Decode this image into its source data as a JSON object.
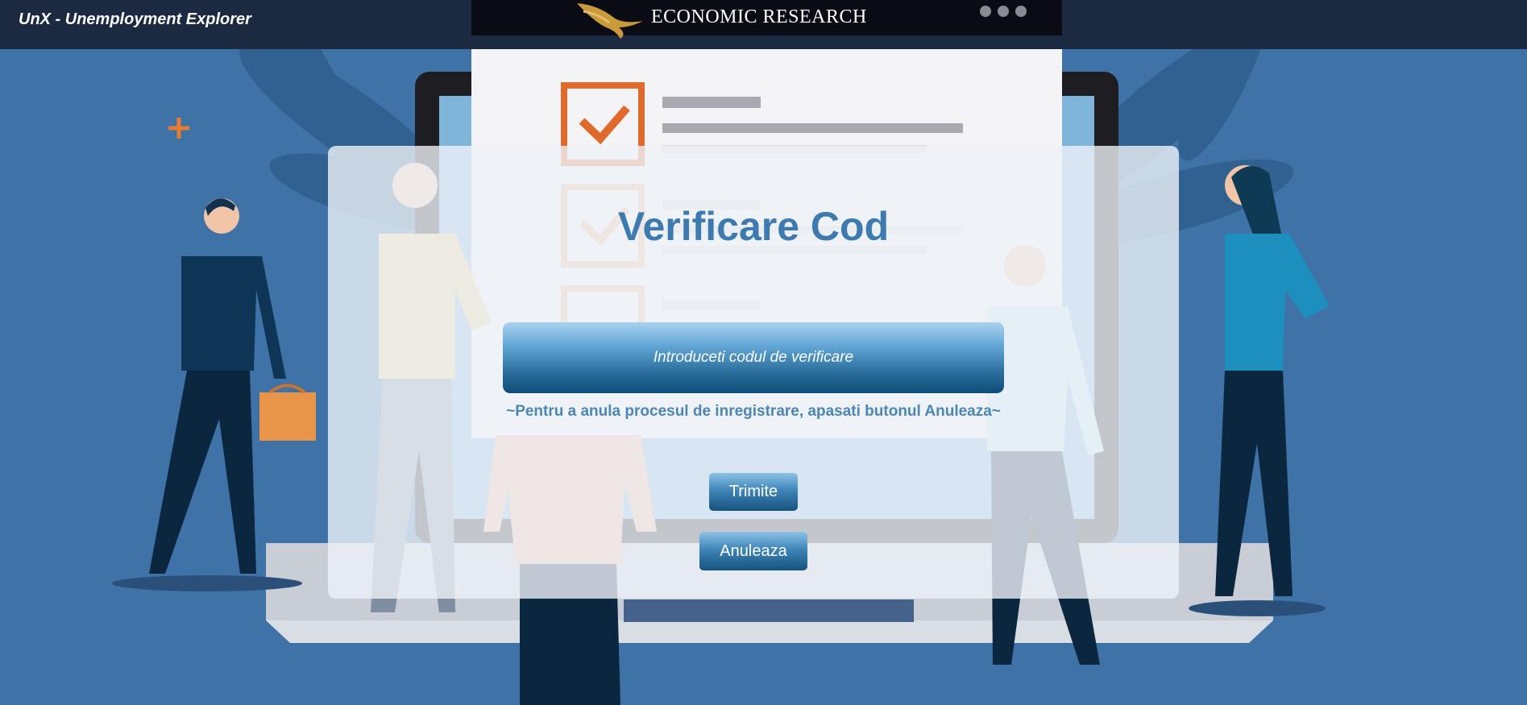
{
  "header": {
    "app_title": "UnX - Unemployment Explorer"
  },
  "brand": {
    "name": "ECONOMIC RESEARCH"
  },
  "dialog": {
    "title": "Verificare Cod",
    "code_input": {
      "value": "",
      "placeholder": "Introduceti codul de verificare"
    },
    "hint": "~Pentru a anula procesul de inregistrare, apasati butonul Anuleaza~",
    "submit_label": "Trimite",
    "cancel_label": "Anuleaza"
  },
  "colors": {
    "background": "#3f72a6",
    "header": "#1b2a40",
    "title": "#3d7ab0",
    "button": "#2b6f9e",
    "accent_orange": "#e87a32"
  }
}
